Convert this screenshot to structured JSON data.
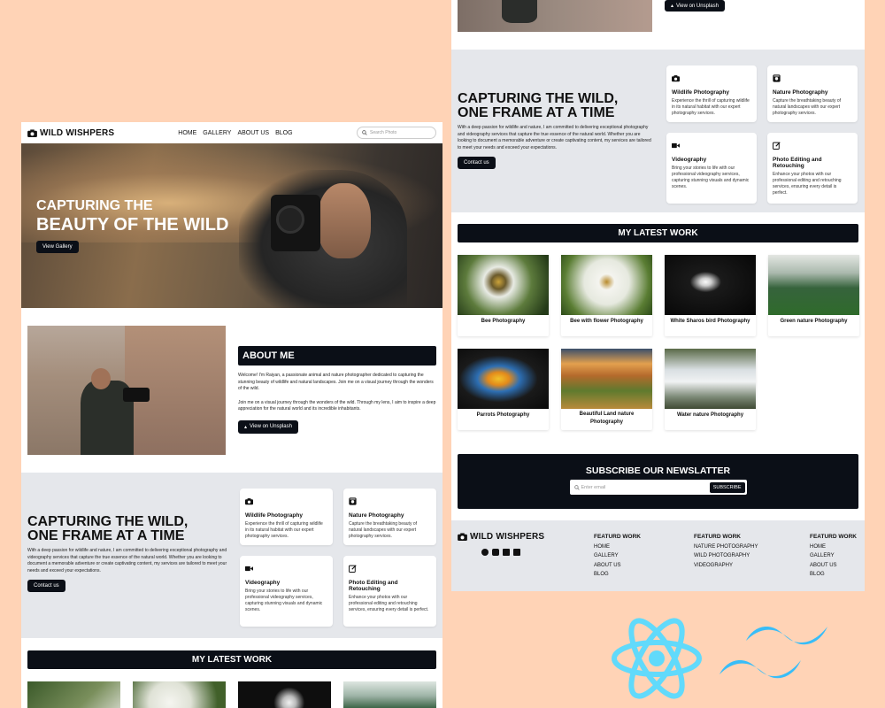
{
  "brand": "WILD WISHPERS",
  "nav": [
    "HOME",
    "GALLERY",
    "ABOUT US",
    "BLOG"
  ],
  "search": {
    "placeholder": "Search Photo"
  },
  "hero": {
    "line1": "CAPTURING THE",
    "line2": "BEAUTY OF THE WILD",
    "button": "View Gallery"
  },
  "about": {
    "title": "ABOUT ME",
    "p1": "Welcome! I'm Raiyan, a passionate animal and nature photographer dedicated to capturing the stunning beauty of wildlife and natural landscapes. Join me on a visual journey through the wonders of the wild.",
    "p2": "Join me on a visual journey through the wonders of the wild. Through my lens, I aim to inspire a deep appreciation for the natural world and its incredible inhabitants.",
    "button": "View on Unsplash"
  },
  "services": {
    "title1": "CAPTURING THE WILD,",
    "title2": "ONE FRAME AT A TIME",
    "text": "With a deep passion for wildlife and nature, I am committed to delivering exceptional photography and videography services that capture the true essence of the natural world. Whether you are looking to document a memorable adventure or create captivating content, my services are tailored to meet your needs and exceed your expectations.",
    "button": "Contact us",
    "cards": [
      {
        "title": "Wildlife Photography",
        "text": "Experience the thrill of capturing wildlife in its natural habitat with our expert photography services.",
        "icon": "camera-icon"
      },
      {
        "title": "Nature Photography",
        "text": "Capture the breathtaking beauty of natural landscapes with our expert photography services.",
        "icon": "photo-camera-icon"
      },
      {
        "title": "Videography",
        "text": "Bring your stories to life with our professional videography services, capturing stunning visuals and dynamic scenes.",
        "icon": "video-icon"
      },
      {
        "title": "Photo Editing and Retouching",
        "text": "Enhance your photos with our professional editing and retouching services, ensuring every detail is perfect.",
        "icon": "edit-icon"
      }
    ]
  },
  "latest": {
    "title": "MY LATEST WORK",
    "items": [
      {
        "caption": "Bee Photography"
      },
      {
        "caption": "Bee with flower Photography"
      },
      {
        "caption": "White Sharos bird Photography"
      },
      {
        "caption": "Green nature Photography"
      },
      {
        "caption": "Parrots Photography"
      },
      {
        "caption": "Beautiful Land nature Photography"
      },
      {
        "caption": "Water nature Photography"
      }
    ]
  },
  "newsletter": {
    "title": "SUBSCRIBE OUR NEWSLATTER",
    "placeholder": "Enter email",
    "button": "SUBSCRIBE"
  },
  "footer": {
    "col1": {
      "title": "FEATURD WORK",
      "links": [
        "HOME",
        "GALLERY",
        "ABOUT US",
        "BLOG"
      ]
    },
    "col2": {
      "title": "FEATURD WORK",
      "links": [
        "NATURE PHOTOGRAPHY",
        "WILD PHOTOGRAPHY",
        "VIDEOGRAPHY"
      ]
    },
    "col3": {
      "title": "FEATURD WORK",
      "links": [
        "HOME",
        "GALLERY",
        "ABOUT US",
        "BLOG"
      ]
    },
    "social": [
      "facebook-icon",
      "instagram-icon",
      "unsplash-icon",
      "linkedin-icon"
    ]
  },
  "colors": {
    "background": "#ffd3b6",
    "dark": "#0b0f17",
    "section_gray": "#e5e7eb",
    "react": "#61dafb",
    "tailwind": "#38bdf8"
  }
}
